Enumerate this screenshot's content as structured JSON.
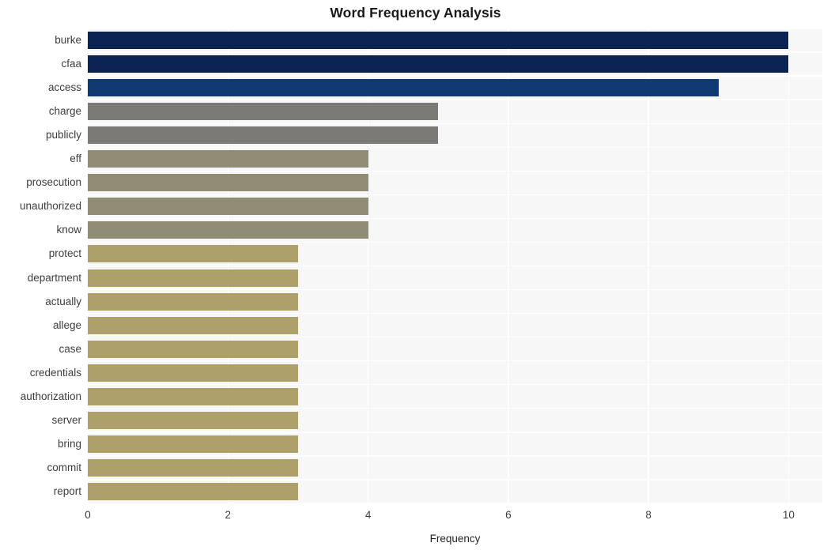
{
  "chart_data": {
    "type": "bar",
    "orientation": "horizontal",
    "title": "Word Frequency Analysis",
    "xlabel": "Frequency",
    "ylabel": "",
    "xlim": [
      0,
      10.48
    ],
    "xticks": [
      0,
      2,
      4,
      6,
      8,
      10
    ],
    "xtick_labels": [
      "0",
      "2",
      "4",
      "6",
      "8",
      "10"
    ],
    "grid": true,
    "grid_color": "#ffffff",
    "plot_background": "#f7f7f7",
    "figure_background": "#ffffff",
    "legend": null,
    "categories": [
      "burke",
      "cfaa",
      "access",
      "charge",
      "publicly",
      "eff",
      "prosecution",
      "unauthorized",
      "know",
      "protect",
      "department",
      "actually",
      "allege",
      "case",
      "credentials",
      "authorization",
      "server",
      "bring",
      "commit",
      "report"
    ],
    "values": [
      10,
      10,
      9,
      5,
      5,
      4,
      4,
      4,
      4,
      3,
      3,
      3,
      3,
      3,
      3,
      3,
      3,
      3,
      3,
      3
    ],
    "bar_colors": [
      "#0a2350",
      "#0a2350",
      "#123a72",
      "#7b7a77",
      "#7b7a77",
      "#918c74",
      "#918c74",
      "#918c74",
      "#918c74",
      "#aea06a",
      "#aea06a",
      "#aea06a",
      "#aea06a",
      "#aea06a",
      "#aea06a",
      "#aea06a",
      "#aea06a",
      "#aea06a",
      "#aea06a",
      "#aea06a"
    ]
  }
}
